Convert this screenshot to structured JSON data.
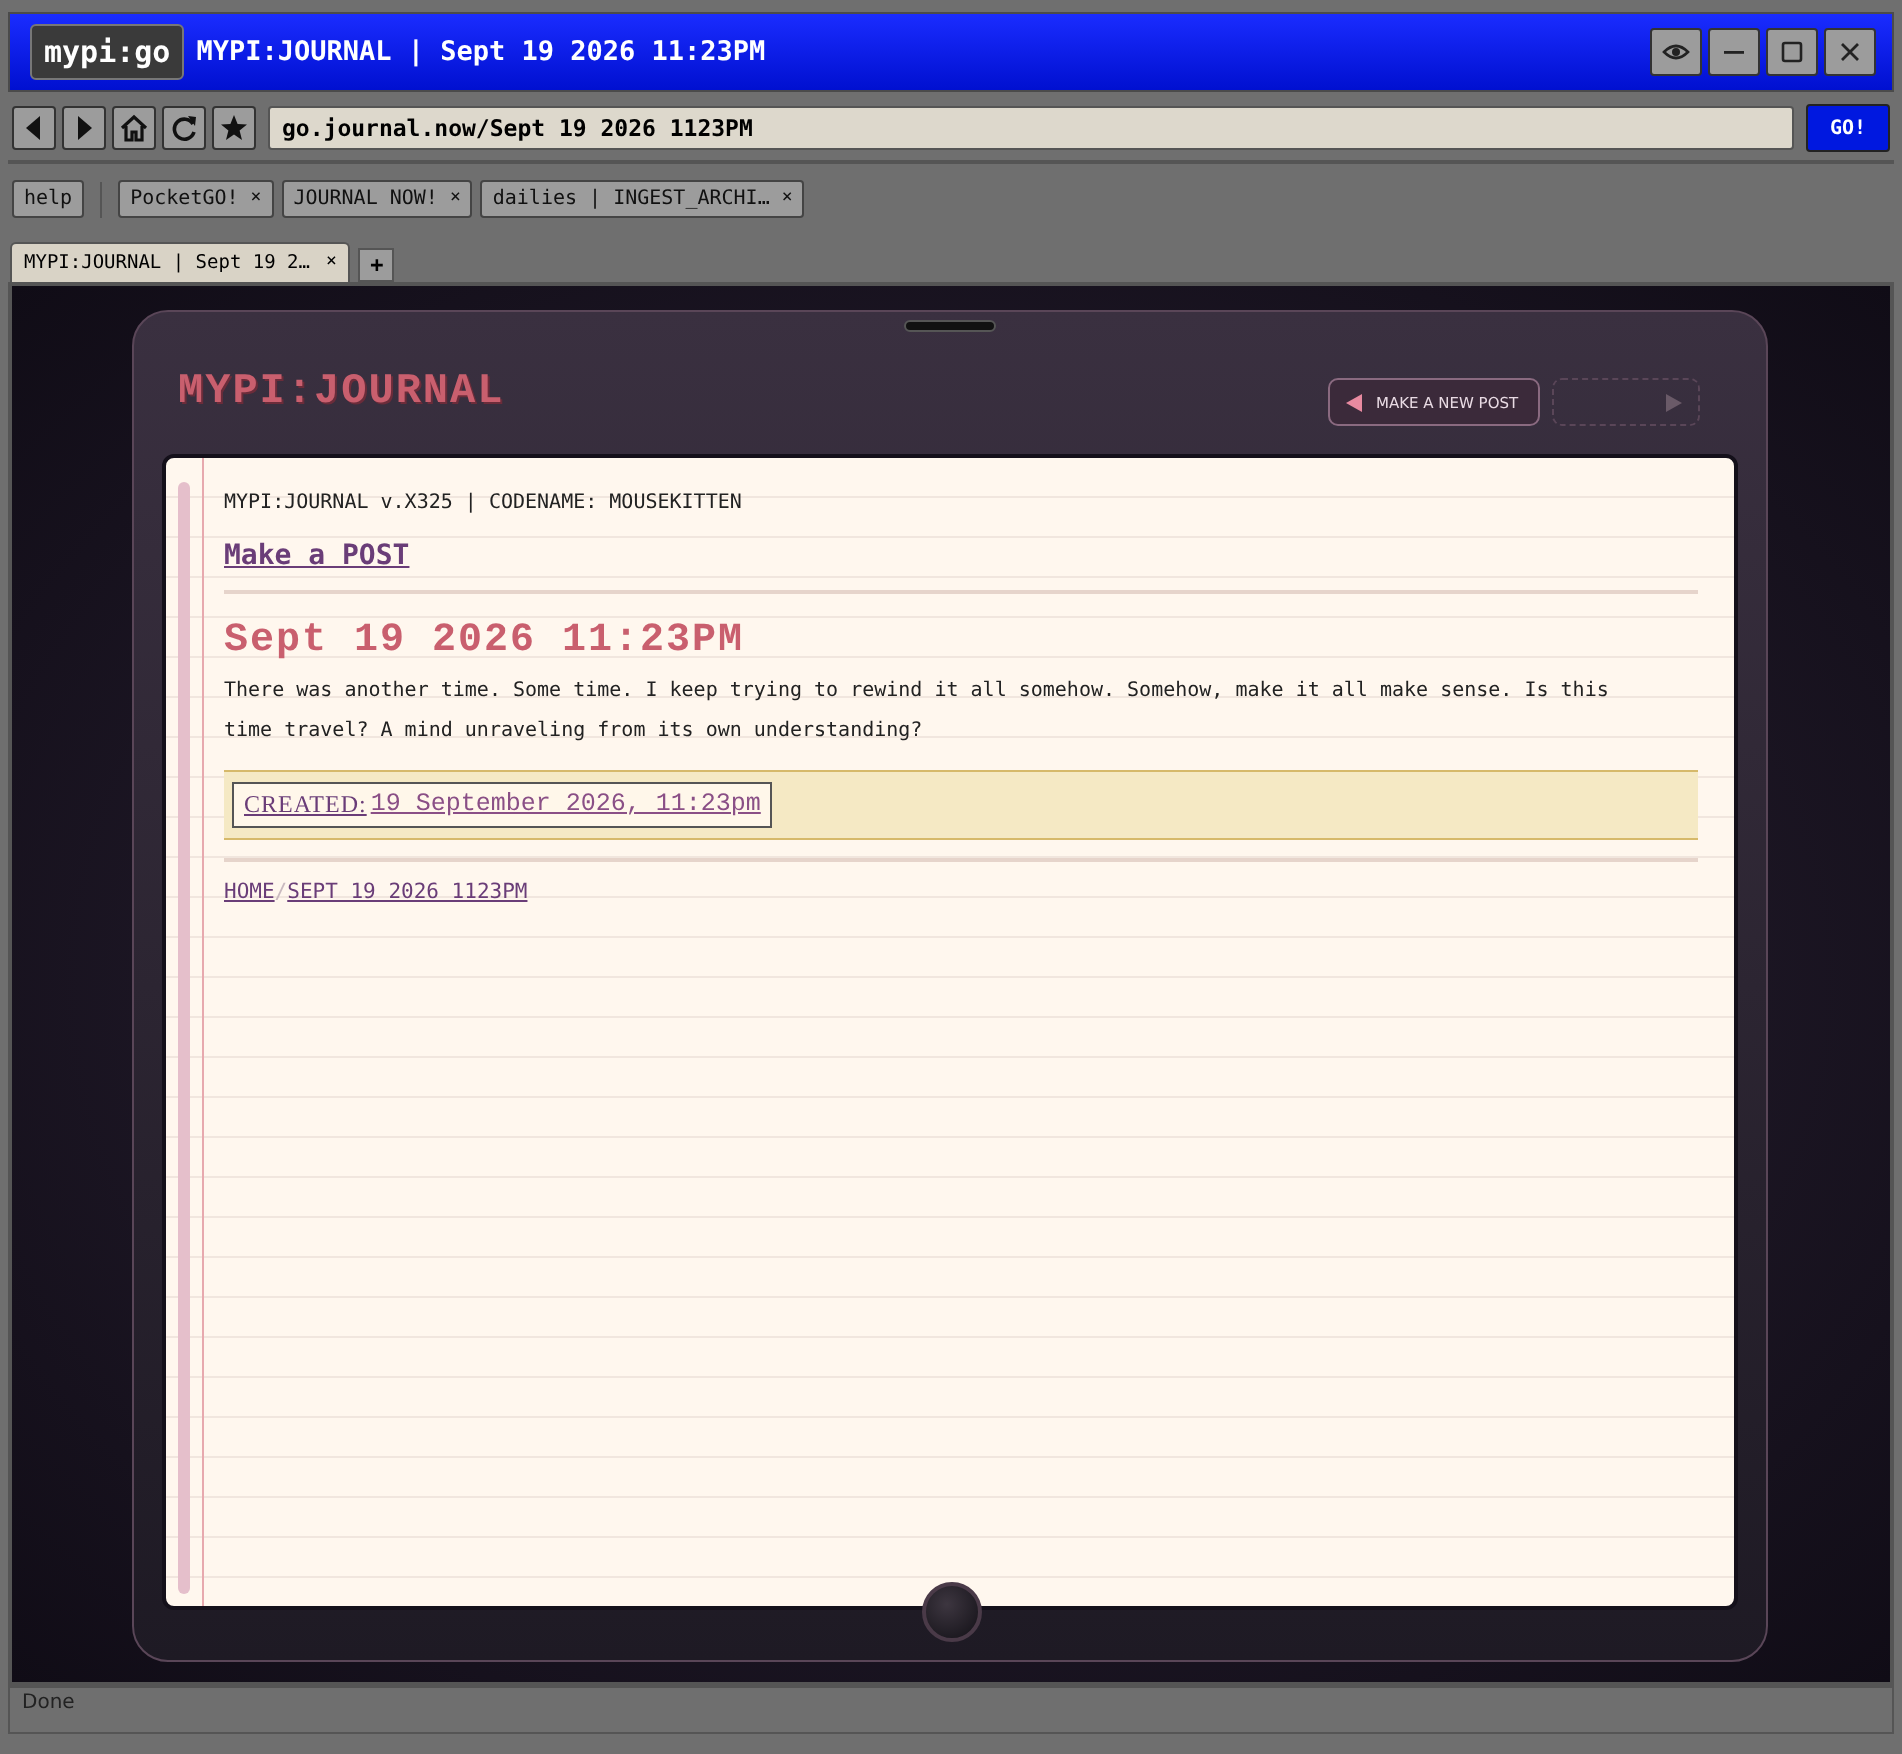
{
  "app": {
    "badge": "mypi:go",
    "title": "MYPI:JOURNAL | Sept 19 2026 11:23PM"
  },
  "address": {
    "value": "go.journal.now/Sept 19 2026 1123PM",
    "go": "GO!"
  },
  "bookmarks": [
    {
      "label": "help"
    },
    {
      "label": "PocketGO!",
      "close": "×"
    },
    {
      "label": "JOURNAL NOW!",
      "close": "×"
    },
    {
      "label": "dailies | INGEST_ARCHI…",
      "close": "×"
    }
  ],
  "tabs": [
    {
      "label": "MYPI:JOURNAL | Sept 19 2…",
      "close": "×",
      "selected": true
    }
  ],
  "new_tab": "+",
  "journal": {
    "logo": "MYPI:JOURNAL",
    "nav": [
      {
        "kind": "prev",
        "label": "MAKE A NEW POST",
        "disabled": false
      },
      {
        "kind": "next",
        "disabled": true
      }
    ],
    "version": "MYPI:JOURNAL v.X325 | CODENAME: MOUSEKITTEN",
    "make_post": "Make a POST",
    "post_title": "Sept 19 2026 11:23PM",
    "body": "There was another time. Some time. I keep trying to rewind it all somehow. Somehow, make it all make sense. Is this time travel? A mind unraveling from its own understanding?",
    "created_label": "CREATED:",
    "created_value": "19 September 2026, 11:23pm",
    "breadcrumbs": [
      "HOME",
      "SEPT 19 2026 1123PM"
    ],
    "breadcrumb_separator": "/"
  },
  "status_bar": "Done"
}
